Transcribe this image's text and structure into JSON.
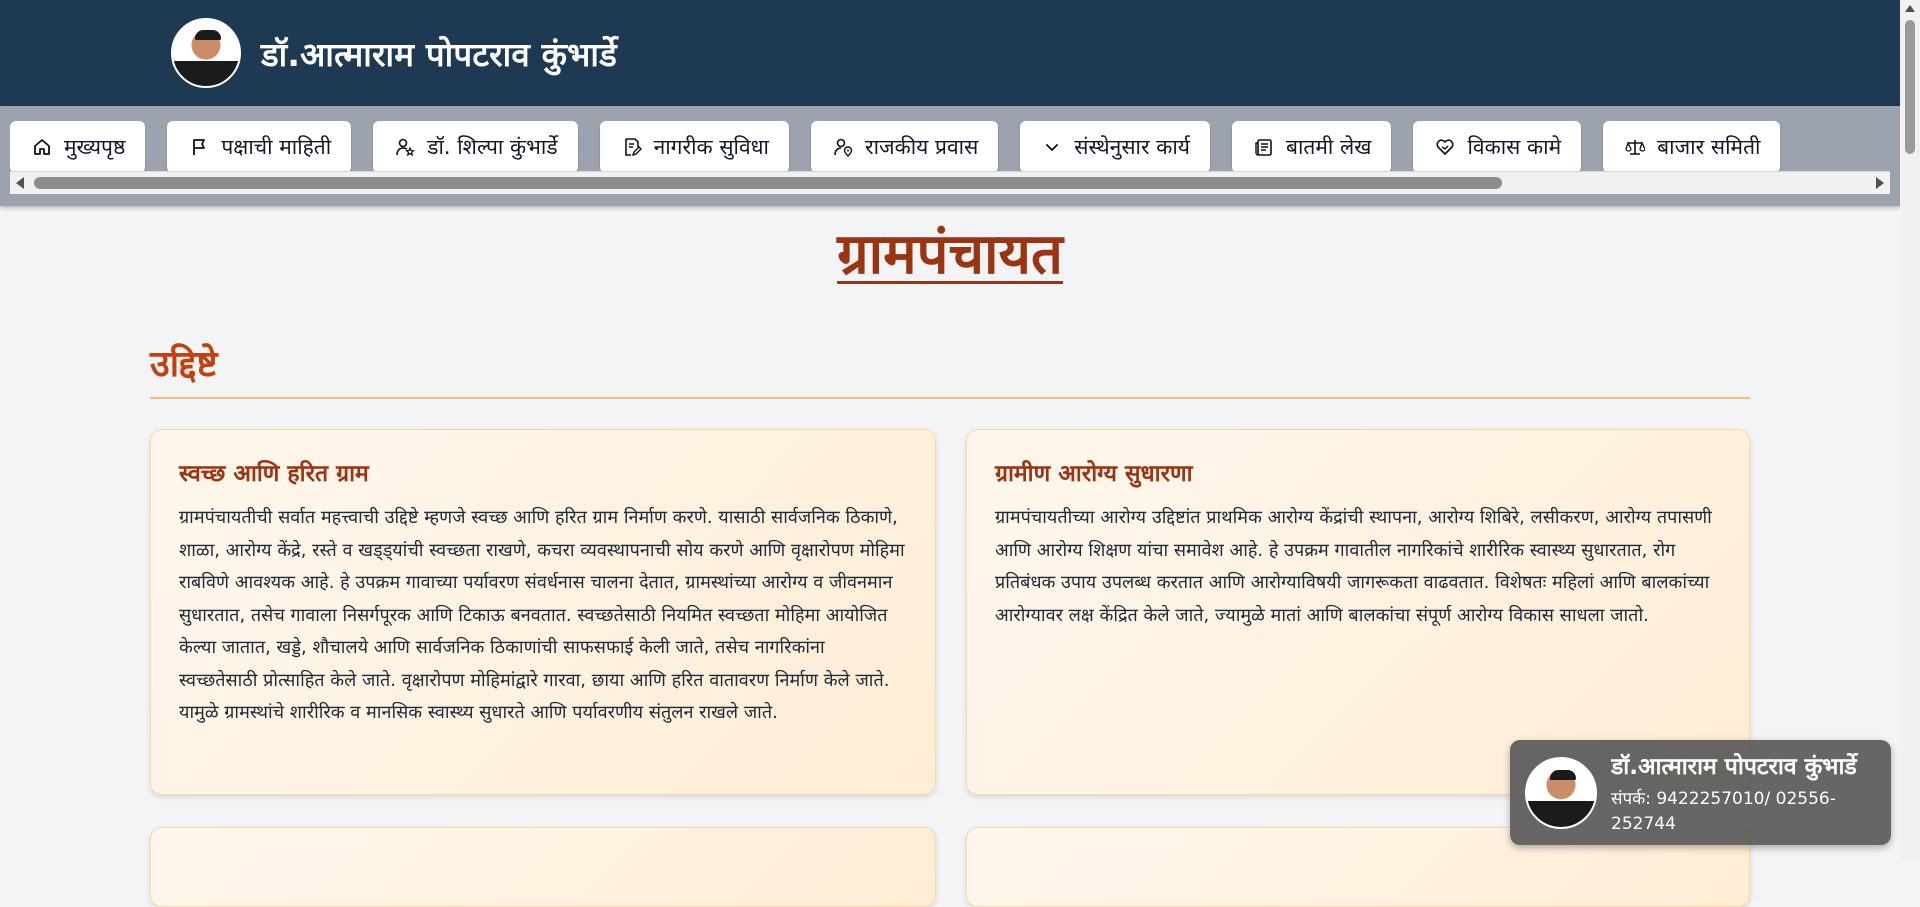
{
  "header": {
    "site_title": "डॉ.आत्माराम पोपटराव कुंभार्डे"
  },
  "nav": {
    "items": [
      {
        "label": "मुख्यपृष्ठ",
        "icon": "home-icon"
      },
      {
        "label": "पक्षाची माहिती",
        "icon": "flag-icon"
      },
      {
        "label": "डॉ. शिल्पा कुंभार्डे",
        "icon": "user-star-icon"
      },
      {
        "label": "नागरीक सुविधा",
        "icon": "document-pen-icon"
      },
      {
        "label": "राजकीय प्रवास",
        "icon": "user-location-icon"
      },
      {
        "label": "संस्थेनुसार कार्य",
        "icon": "chevron-down-icon"
      },
      {
        "label": "बातमी लेख",
        "icon": "newspaper-icon"
      },
      {
        "label": "विकास कामे",
        "icon": "handshake-heart-icon"
      },
      {
        "label": "बाजार समिती",
        "icon": "scale-icon"
      }
    ]
  },
  "main": {
    "page_title": "ग्रामपंचायत",
    "section_heading": "उद्दिष्टे",
    "cards": [
      {
        "title": "स्वच्छ आणि हरित ग्राम",
        "body": "ग्रामपंचायतीची सर्वात महत्त्वाची उद्दिष्टे म्हणजे स्वच्छ आणि हरित ग्राम निर्माण करणे. यासाठी सार्वजनिक ठिकाणे, शाळा, आरोग्य केंद्रे, रस्ते व खड्ड्यांची स्वच्छता राखणे, कचरा व्यवस्थापनाची सोय करणे आणि वृक्षारोपण मोहिमा राबविणे आवश्यक आहे. हे उपक्रम गावाच्या पर्यावरण संवर्धनास चालना देतात, ग्रामस्थांच्या आरोग्य व जीवनमान सुधारतात, तसेच गावाला निसर्गपूरक आणि टिकाऊ बनवतात. स्वच्छतेसाठी नियमित स्वच्छता मोहिमा आयोजित केल्या जातात, खड्डे, शौचालये आणि सार्वजनिक ठिकाणांची साफसफाई केली जाते, तसेच नागरिकांना स्वच्छतेसाठी प्रोत्साहित केले जाते. वृक्षारोपण मोहिमांद्वारे गारवा, छाया आणि हरित वातावरण निर्माण केले जाते. यामुळे ग्रामस्थांचे शारीरिक व मानसिक स्वास्थ्य सुधारते आणि पर्यावरणीय संतुलन राखले जाते."
      },
      {
        "title": "ग्रामीण आरोग्य सुधारणा",
        "body": "ग्रामपंचायतीच्या आरोग्य उद्दिष्टांत प्राथमिक आरोग्य केंद्रांची स्थापना, आरोग्य शिबिरे, लसीकरण, आरोग्य तपासणी आणि आरोग्य शिक्षण यांचा समावेश आहे. हे उपक्रम गावातील नागरिकांचे शारीरिक स्वास्थ्य सुधारतात, रोग प्रतिबंधक उपाय उपलब्ध करतात आणि आरोग्याविषयी जागरूकता वाढवतात. विशेषतः महिलां आणि बालकांच्या आरोग्यावर लक्ष केंद्रित केले जाते, ज्यामुळे मातां आणि बालकांचा संपूर्ण आरोग्य विकास साधला जातो."
      }
    ]
  },
  "contact_popup": {
    "name": "डॉ.आत्माराम पोपटराव कुंभार्डे",
    "phone": "संपर्क: 9422257010/ 02556-252744"
  },
  "colors": {
    "header_bg": "#1e3a52",
    "nav_bg": "#9ca3af",
    "accent": "#9a3412",
    "card_bg": "#fff7ed"
  }
}
